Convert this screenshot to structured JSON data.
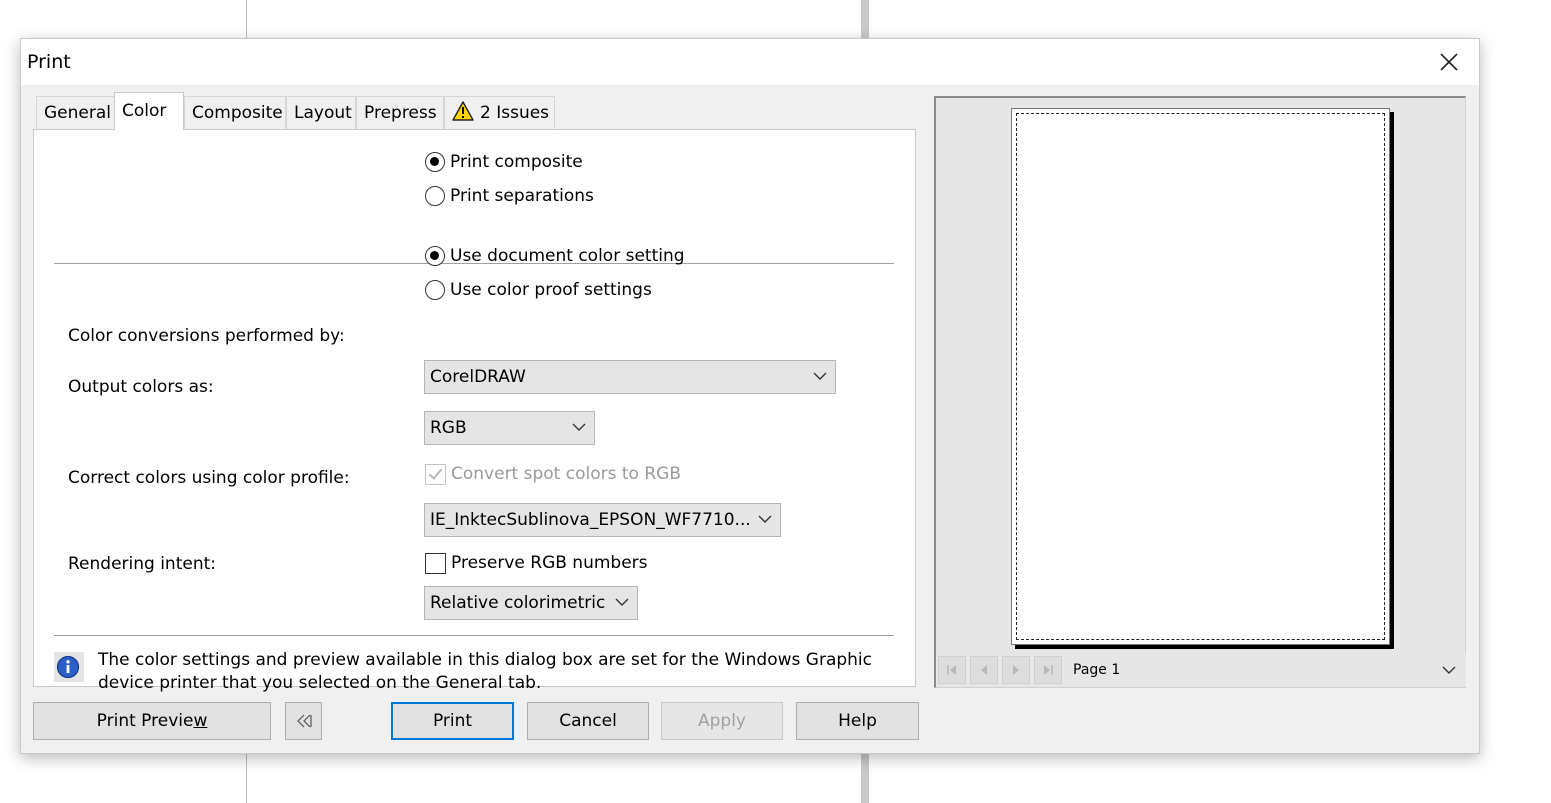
{
  "dialog": {
    "title": "Print",
    "close_icon": "close-icon"
  },
  "tabs": [
    {
      "label": "General",
      "active": false
    },
    {
      "label": "Color",
      "active": true
    },
    {
      "label": "Composite",
      "active": false
    },
    {
      "label": "Layout",
      "active": false
    },
    {
      "label": "Prepress",
      "active": false
    },
    {
      "label": "2 Issues",
      "active": false,
      "icon": "warning-icon"
    }
  ],
  "color_tab": {
    "print_mode": {
      "options": [
        "Print composite",
        "Print separations"
      ],
      "selected": "Print composite"
    },
    "color_setting": {
      "options": [
        "Use document color setting",
        "Use color proof settings"
      ],
      "selected": "Use document color setting"
    },
    "conversions": {
      "label": "Color conversions performed by:",
      "value": "CorelDRAW"
    },
    "output_colors": {
      "label": "Output colors as:",
      "value": "RGB"
    },
    "convert_spot": {
      "label": "Convert spot colors to RGB",
      "checked": true,
      "enabled": false
    },
    "color_profile": {
      "label": "Correct colors using color profile:",
      "value": "IE_InktecSublinova_EPSON_WF7710..."
    },
    "preserve_rgb": {
      "label": "Preserve RGB numbers",
      "checked": false
    },
    "rendering_intent": {
      "label": "Rendering intent:",
      "value": "Relative colorimetric"
    },
    "info_text": "The color settings and preview available in this dialog box are set for the Windows Graphic device printer that you selected on the General tab.",
    "info_icon": "info-icon"
  },
  "buttons": {
    "print_preview": "Print Previe",
    "print_preview_mnemonic": "w",
    "collapse_icon": "collapse-preview-icon",
    "print": "Print",
    "cancel": "Cancel",
    "apply": "Apply",
    "help": "Help"
  },
  "preview": {
    "page_select": "Page 1",
    "nav_icons": [
      "first-page-icon",
      "previous-page-icon",
      "next-page-icon",
      "last-page-icon"
    ]
  },
  "colors": {
    "dialog_bg": "#f0f0f0",
    "focus_border": "#0078d7",
    "warning_yellow": "#ffd400"
  }
}
